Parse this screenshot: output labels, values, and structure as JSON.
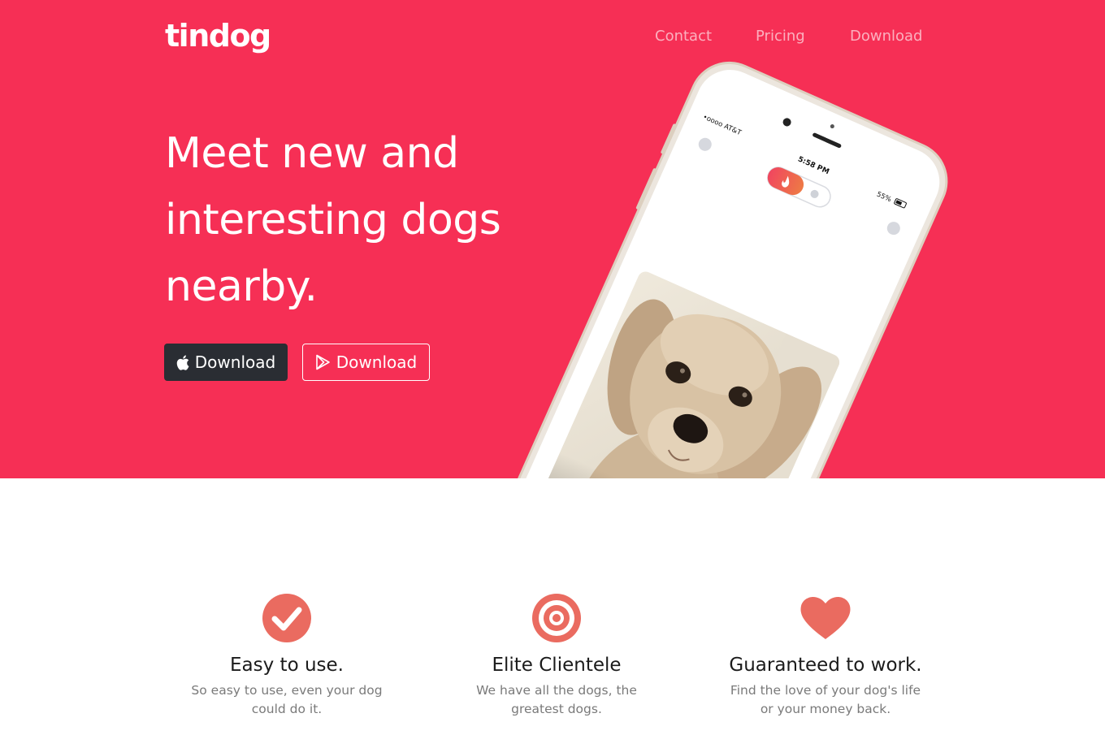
{
  "brand": {
    "name": "tindog"
  },
  "colors": {
    "hero_bg": "#f62f55",
    "accent": "#ea6b60",
    "dark_button": "#2a2d33"
  },
  "nav": {
    "items": [
      {
        "label": "Contact"
      },
      {
        "label": "Pricing"
      },
      {
        "label": "Download"
      }
    ]
  },
  "hero": {
    "title_lines": [
      "Meet new and",
      "interesting dogs",
      "nearby."
    ],
    "buttons": {
      "apple": {
        "label": "Download",
        "icon": "apple-icon"
      },
      "play": {
        "label": "Download",
        "icon": "google-play-icon"
      }
    }
  },
  "phone": {
    "carrier": "•oooo AT&T",
    "time": "5:58 PM",
    "battery": "55%"
  },
  "features": [
    {
      "icon": "check-circle-icon",
      "title": "Easy to use.",
      "desc": "So easy to use, even your dog could do it."
    },
    {
      "icon": "bullseye-icon",
      "title": "Elite Clientele",
      "desc": "We have all the dogs, the greatest dogs."
    },
    {
      "icon": "heart-icon",
      "title": "Guaranteed to work.",
      "desc": "Find the love of your dog's life or your money back."
    }
  ]
}
